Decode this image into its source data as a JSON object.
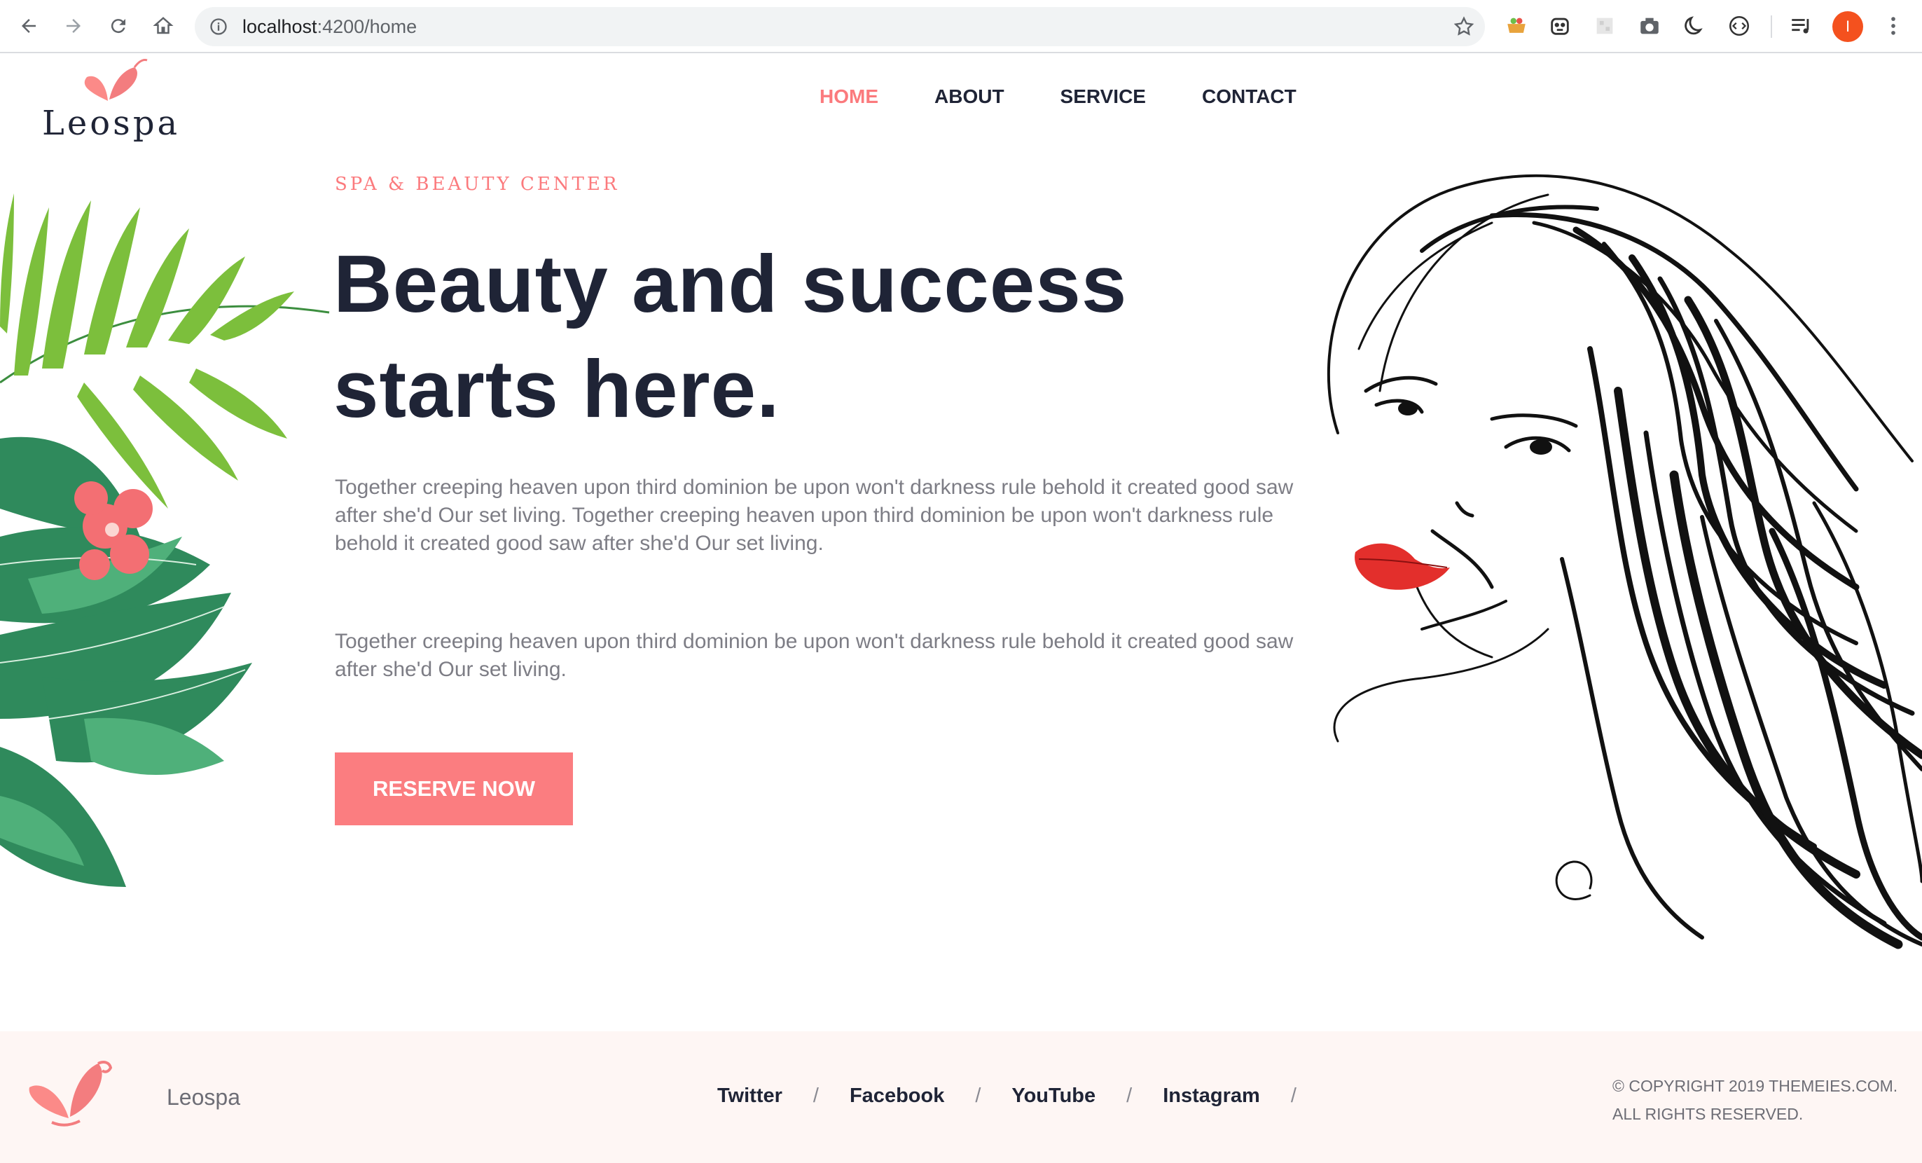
{
  "browser": {
    "url_host": "localhost",
    "url_path": ":4200/home",
    "profile_initial": "I"
  },
  "site": {
    "brand": "Leospa",
    "nav": [
      {
        "label": "HOME",
        "active": true
      },
      {
        "label": "ABOUT",
        "active": false
      },
      {
        "label": "SERVICE",
        "active": false
      },
      {
        "label": "CONTACT",
        "active": false
      }
    ]
  },
  "hero": {
    "eyebrow": "SPA & BEAUTY CENTER",
    "title_line1": "Beauty and success",
    "title_line2": "starts here.",
    "paragraph1": "Together creeping heaven upon third dominion be upon won't darkness rule behold it created good saw after she'd Our set living. Together creeping heaven upon third dominion be upon won't darkness rule behold it created good saw after she'd Our set living.",
    "paragraph2": "Together creeping heaven upon third dominion be upon won't darkness rule behold it created good saw after she'd Our set living.",
    "cta": "RESERVE NOW"
  },
  "footer": {
    "brand": "Leospa",
    "social": [
      "Twitter",
      "Facebook",
      "YouTube",
      "Instagram"
    ],
    "separator": "/",
    "copyright_line1": "© COPYRIGHT 2019 THEMEIES.COM.",
    "copyright_line2": "ALL RIGHTS RESERVED."
  },
  "colors": {
    "accent": "#fb7a7d",
    "dark": "#1f2436",
    "footer_bg": "#fef6f4"
  }
}
